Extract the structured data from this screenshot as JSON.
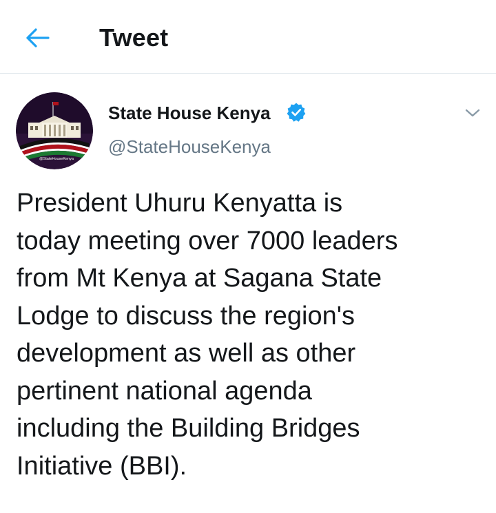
{
  "header": {
    "title": "Tweet",
    "back_icon": "arrow-left-icon"
  },
  "tweet": {
    "avatar_icon": "state-house-kenya-logo",
    "avatar_caption": "@StateHouseKenya",
    "display_name": "State House Kenya",
    "verified_icon": "verified-badge-icon",
    "handle": "@StateHouseKenya",
    "menu_icon": "chevron-down-icon",
    "text": "President Uhuru Kenyatta is\ntoday meeting over 7000 leaders\nfrom Mt Kenya at Sagana State\nLodge to discuss the region's\ndevelopment as well as other\npertinent national agenda\nincluding the Building Bridges\nInitiative (BBI)."
  },
  "colors": {
    "accent": "#1da1f2",
    "text_primary": "#14171a",
    "text_secondary": "#657786",
    "divider": "#e1e8ed"
  }
}
